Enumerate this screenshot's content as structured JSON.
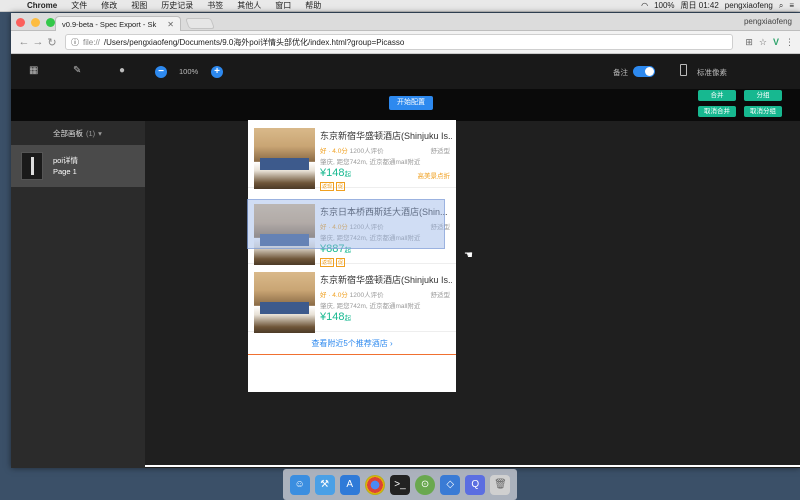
{
  "menubar": {
    "apple": "",
    "app": "Chrome",
    "items": [
      "文件",
      "修改",
      "视图",
      "历史记录",
      "书签",
      "其他人",
      "窗口",
      "帮助"
    ],
    "battery": "100%",
    "clock": "周日 01:42",
    "user": "pengxiaofeng"
  },
  "browser": {
    "tab_title": "v0.9-beta - Spec Export - Sk",
    "user_label": "pengxiaofeng",
    "url_scheme": "file://",
    "url_path": "/Users/pengxiaofeng/Documents/9.0海外poi详情头部优化/index.html?group=Picasso"
  },
  "app_toolbar": {
    "zoom_out": "−",
    "zoom_value": "100%",
    "zoom_in": "+",
    "note_label": "备注",
    "device_label": "标准像素",
    "accent": "#2d89ef"
  },
  "actions": {
    "start": "开始配置",
    "merge": "合并",
    "group": "分组",
    "unmerge": "取消合并",
    "ungroup": "取消分组",
    "green": "#17b890"
  },
  "sidebar": {
    "header": "全部画板",
    "count": "(1)",
    "item_title": "poi详情",
    "item_sub": "Page 1"
  },
  "hotels": [
    {
      "name": "东京新宿华盛顿酒店(Shinjuku Is...",
      "score": "好 · 4.0分",
      "reviews": "1200人评价",
      "type": "舒适型",
      "loc": "肇庆, 距您742m, 近京都通mall附近",
      "price": "¥148",
      "price_unit": "起",
      "promo": "高美景点折",
      "tags": [
        "返现",
        "促"
      ]
    },
    {
      "name": "东京日本桥西斯廷大酒店(Shin...",
      "score": "好 · 4.0分",
      "reviews": "1200人评价",
      "type": "舒适型",
      "loc": "肇庆, 距您742m, 近京都通mall附近",
      "price": "¥887",
      "price_unit": "起",
      "promo": "",
      "tags": [
        "返现",
        "促"
      ]
    },
    {
      "name": "东京新宿华盛顿酒店(Shinjuku Is...",
      "score": "好 · 4.0分",
      "reviews": "1200人评价",
      "type": "舒适型",
      "loc": "肇庆, 距您742m, 近京都通mall附近",
      "price": "¥148",
      "price_unit": "起",
      "promo": "",
      "tags": []
    }
  ],
  "view_more": "查看附近5个推荐酒店 ›"
}
